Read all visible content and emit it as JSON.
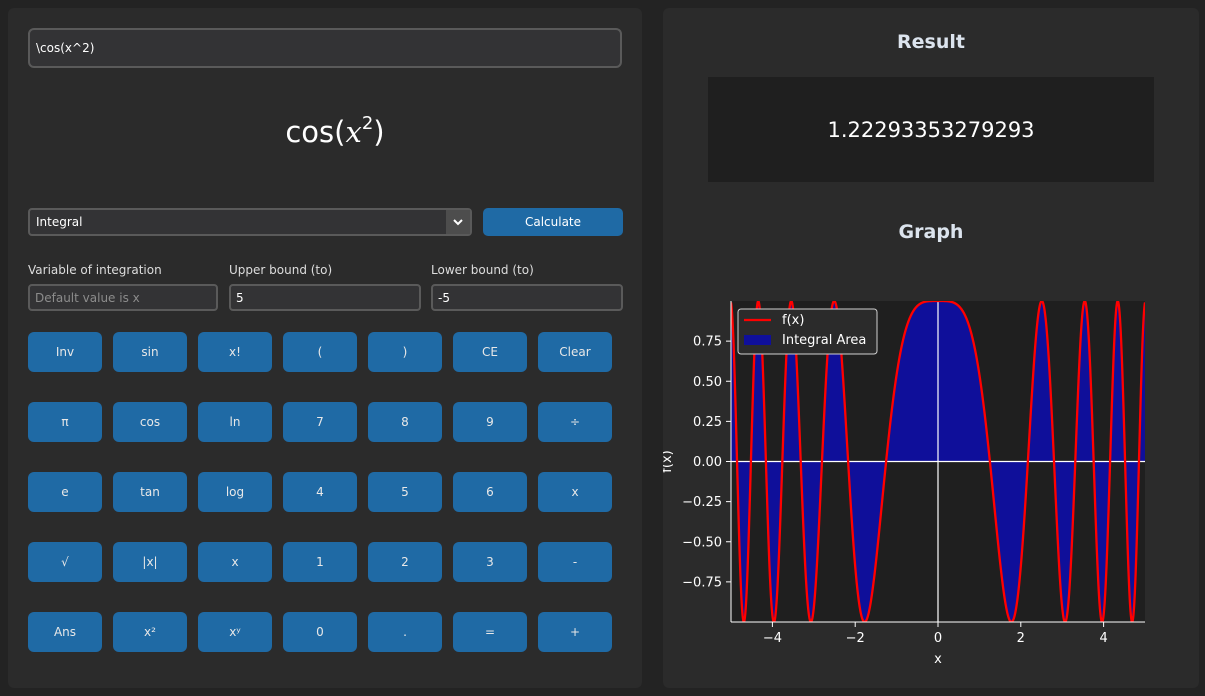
{
  "expression": {
    "value": "\\cos(x^2)"
  },
  "preview": {
    "fn": "cos(",
    "var": "x",
    "exp": "2",
    "close": ")"
  },
  "operation": {
    "selected": "Integral",
    "calculate_label": "Calculate"
  },
  "fields": {
    "variable": {
      "label": "Variable of integration",
      "value": "",
      "placeholder": "Default value is x"
    },
    "upper": {
      "label": "Upper bound (to)",
      "value": "5"
    },
    "lower": {
      "label": "Lower bound (to)",
      "value": "-5"
    }
  },
  "keypad": [
    [
      "Inv",
      "sin",
      "x!",
      "(",
      ")",
      "CE",
      "Clear"
    ],
    [
      "π",
      "cos",
      "ln",
      "7",
      "8",
      "9",
      "÷"
    ],
    [
      "e",
      "tan",
      "log",
      "4",
      "5",
      "6",
      "x"
    ],
    [
      "√",
      "|x|",
      "x",
      "1",
      "2",
      "3",
      "-"
    ],
    [
      "Ans",
      "x²",
      "xʸ",
      "0",
      ".",
      "=",
      "+"
    ]
  ],
  "result": {
    "heading": "Result",
    "value": "1.22293353279293"
  },
  "graph": {
    "heading": "Graph"
  },
  "chart_data": {
    "type": "area",
    "function": "cos(x^2)",
    "x_range": [
      -5,
      5
    ],
    "bounds": [
      -5,
      5
    ],
    "xlim": [
      -5,
      5
    ],
    "ylim": [
      -1,
      1
    ],
    "xticks": [
      -4,
      -2,
      0,
      2,
      4
    ],
    "yticks": [
      -0.75,
      -0.5,
      -0.25,
      0.0,
      0.25,
      0.5,
      0.75
    ],
    "xlabel": "x",
    "ylabel": "f(x)",
    "series": [
      {
        "name": "f(x)",
        "kind": "line",
        "color": "#ff0000"
      },
      {
        "name": "Integral Area",
        "kind": "fill",
        "color": "#0f0f9a"
      }
    ],
    "legend": "top-left",
    "colors": {
      "background": "#1f1f1f",
      "axes": "#ffffff"
    }
  }
}
